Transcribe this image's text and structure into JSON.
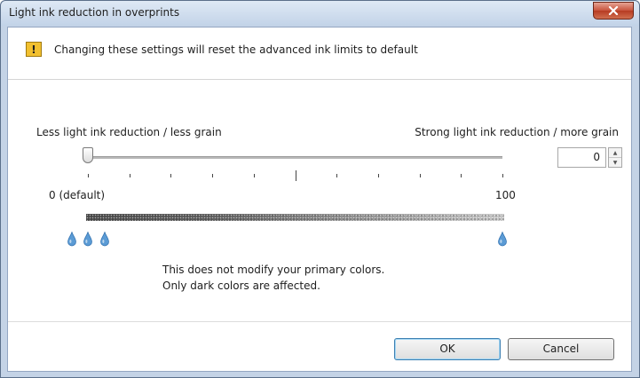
{
  "window": {
    "title": "Light ink reduction in overprints"
  },
  "banner": {
    "icon": "warning-icon",
    "icon_glyph": "!",
    "text": "Changing these settings will reset the advanced ink limits to default"
  },
  "slider": {
    "label_left": "Less light ink reduction / less grain",
    "label_right": "Strong light ink reduction / more grain",
    "min_label": "0 (default)",
    "max_label": "100",
    "min": 0,
    "max": 100,
    "value": 0
  },
  "spinner": {
    "value": "0"
  },
  "info": {
    "line1": "This does not modify your primary colors.",
    "line2": "Only dark colors are affected."
  },
  "buttons": {
    "ok": "OK",
    "cancel": "Cancel"
  },
  "colors": {
    "drop": "#5b9bd5",
    "close_button": "#c8533c",
    "default_button_border": "#3c7fb1"
  }
}
